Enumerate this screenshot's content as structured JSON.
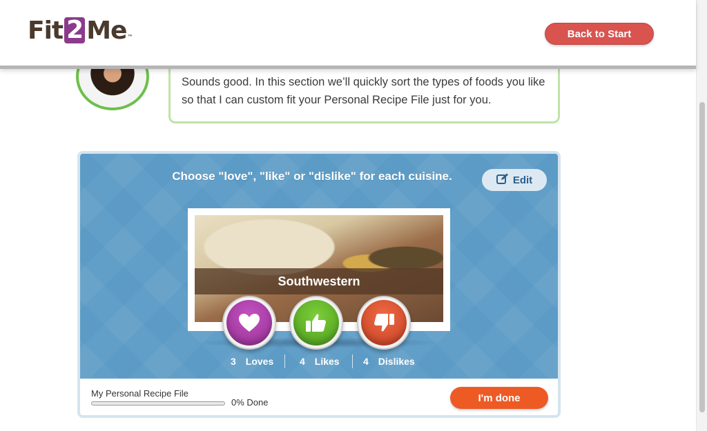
{
  "header": {
    "logo": {
      "part1": "Fit",
      "part2": "2",
      "part3": "Me",
      "tm": "™"
    },
    "back_button": "Back to Start"
  },
  "coach": {
    "message": "Sounds good. In this section we’ll quickly sort the types of foods you like so that I can custom fit your Personal Recipe File just for you."
  },
  "sorter": {
    "instruction": "Choose \"love\", \"like\" or \"dislike\" for each cuisine.",
    "edit_label": "Edit",
    "cuisine": "Southwestern",
    "counts": [
      {
        "value": "3",
        "label": "Loves"
      },
      {
        "value": "4",
        "label": "Likes"
      },
      {
        "value": "4",
        "label": "Dislikes"
      }
    ]
  },
  "footer": {
    "file_label": "My Personal Recipe File",
    "progress_fraction": 0,
    "progress_text": "0% Done",
    "done_button": "I'm done"
  },
  "colors": {
    "card_blue": "#5b9bc6",
    "love": "#a23aa0",
    "like": "#5cb02a",
    "dislike": "#d9502d",
    "back_button": "#d9534f",
    "done_button": "#ee5a24"
  }
}
